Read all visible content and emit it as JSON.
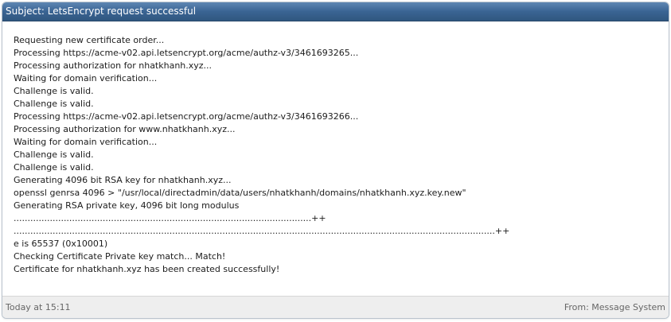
{
  "message": {
    "subject": "Subject: LetsEncrypt request successful",
    "lines": [
      "Requesting new certificate order...",
      "Processing https://acme-v02.api.letsencrypt.org/acme/authz-v3/3461693265...",
      "Processing authorization for nhatkhanh.xyz...",
      "Waiting for domain verification...",
      "Challenge is valid.",
      "Challenge is valid.",
      "Processing https://acme-v02.api.letsencrypt.org/acme/authz-v3/3461693266...",
      "Processing authorization for www.nhatkhanh.xyz...",
      "Waiting for domain verification...",
      "Challenge is valid.",
      "Challenge is valid.",
      "Generating 4096 bit RSA key for nhatkhanh.xyz...",
      "openssl genrsa 4096 > \"/usr/local/directadmin/data/users/nhatkhanh/domains/nhatkhanh.xyz.key.new\"",
      "Generating RSA private key, 4096 bit long modulus",
      "...........................................................................................................++",
      ".............................................................................................................................................................................++",
      "e is 65537 (0x10001)",
      "Checking Certificate Private key match... Match!",
      "Certificate for nhatkhanh.xyz has been created successfully!"
    ],
    "timestamp": "Today at 15:11",
    "from": "From: Message System"
  },
  "colors": {
    "header_top": "#5e86b3",
    "header_bottom": "#30577f",
    "footer_bg": "#eeeeee",
    "border": "#b9c3cd"
  }
}
